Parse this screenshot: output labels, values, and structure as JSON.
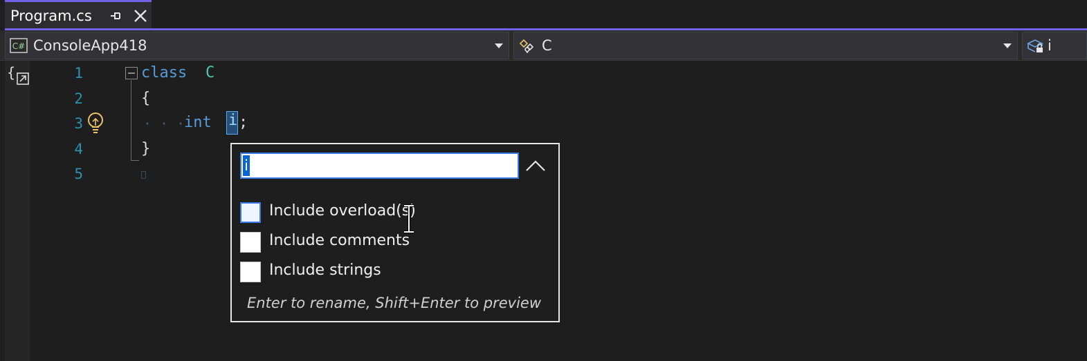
{
  "tab": {
    "title": "Program.cs",
    "pin_icon": "pin-icon",
    "close_icon": "close-icon"
  },
  "navbar": {
    "project": "ConsoleApp418",
    "project_icon": "csharp-project-icon",
    "type": "C",
    "type_icon": "class-icon",
    "member": "i",
    "member_icon": "private-field-icon"
  },
  "editor": {
    "line_numbers": [
      "1",
      "2",
      "3",
      "4",
      "5"
    ],
    "lines": {
      "l1_keyword": "class",
      "l1_name": "C",
      "l2": "{",
      "l3_indent": "· · ·",
      "l3_type": "int",
      "l3_ident": "i",
      "l3_semicolon": ";",
      "l4": "}"
    }
  },
  "rename": {
    "input_value": "i",
    "options": [
      {
        "label": "Include overload(s)",
        "checked": false
      },
      {
        "label": "Include comments",
        "checked": false
      },
      {
        "label": "Include strings",
        "checked": false
      }
    ],
    "hint": "Enter to rename, Shift+Enter to preview"
  },
  "colors": {
    "accent": "#7160e8",
    "keyword": "#569cd6",
    "line_number": "#2b91af",
    "selection": "#0a64d6"
  }
}
